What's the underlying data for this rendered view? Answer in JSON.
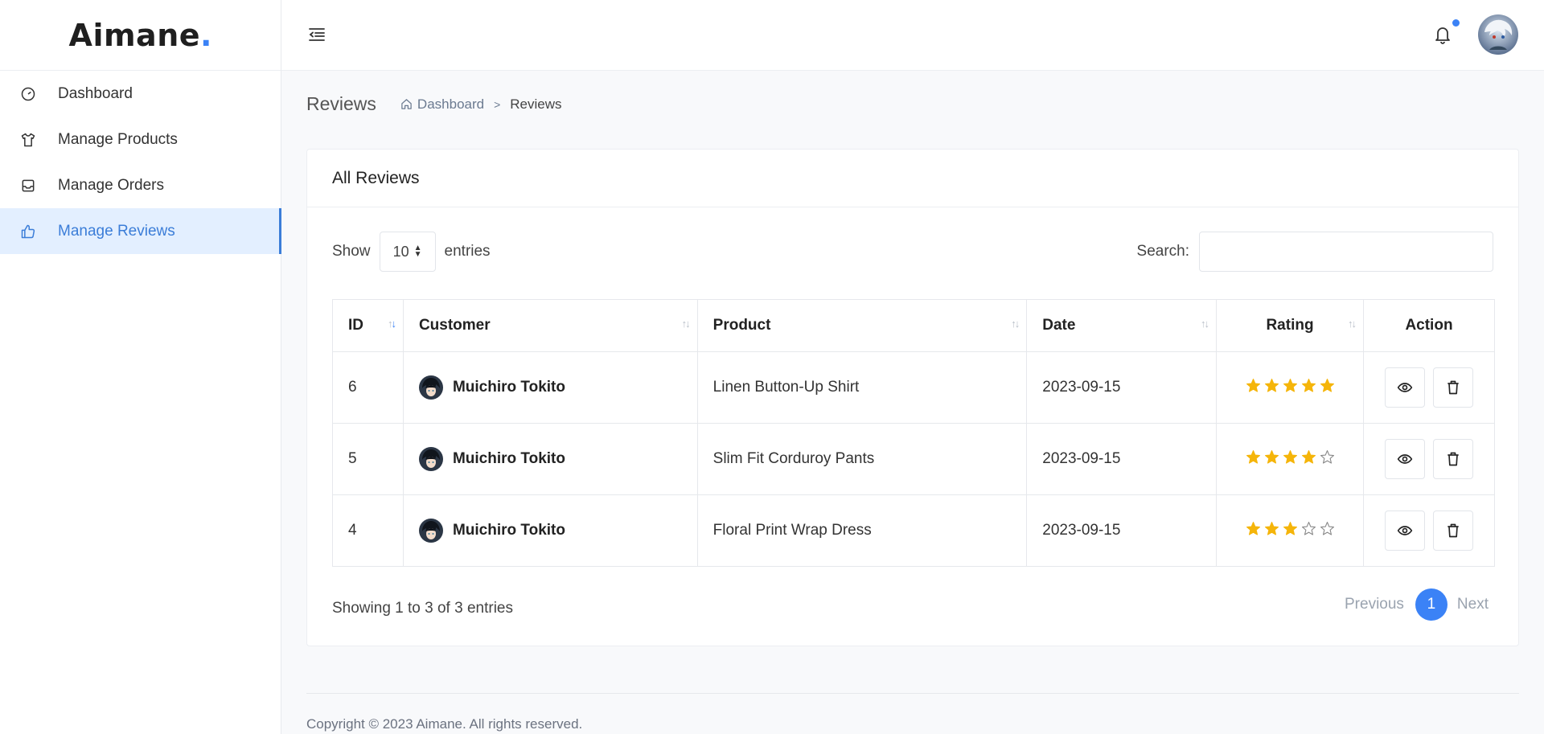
{
  "brand": {
    "name": "Aimane",
    "dot": "."
  },
  "sidebar": {
    "items": [
      {
        "label": "Dashboard"
      },
      {
        "label": "Manage Products"
      },
      {
        "label": "Manage Orders"
      },
      {
        "label": "Manage Reviews",
        "active": true
      }
    ]
  },
  "page": {
    "title": "Reviews"
  },
  "breadcrumb": {
    "home": "Dashboard",
    "separator": ">",
    "current": "Reviews"
  },
  "card": {
    "title": "All Reviews"
  },
  "controls": {
    "show_label": "Show",
    "entries_value": "10",
    "entries_label": "entries",
    "search_label": "Search:",
    "search_value": ""
  },
  "table": {
    "headers": {
      "id": "ID",
      "customer": "Customer",
      "product": "Product",
      "date": "Date",
      "rating": "Rating",
      "action": "Action"
    },
    "rows": [
      {
        "id": "6",
        "customer": "Muichiro Tokito",
        "product": "Linen Button-Up Shirt",
        "date": "2023-09-15",
        "rating": 5
      },
      {
        "id": "5",
        "customer": "Muichiro Tokito",
        "product": "Slim Fit Corduroy Pants",
        "date": "2023-09-15",
        "rating": 4
      },
      {
        "id": "4",
        "customer": "Muichiro Tokito",
        "product": "Floral Print Wrap Dress",
        "date": "2023-09-15",
        "rating": 3
      }
    ]
  },
  "footer_info": {
    "showing": "Showing 1 to 3 of 3 entries"
  },
  "pagination": {
    "previous": "Previous",
    "current_page": "1",
    "next": "Next"
  },
  "copyright": "Copyright © 2023 Aimane. All rights reserved.",
  "colors": {
    "accent": "#3b82f6",
    "star": "#f5b50a",
    "active_bg": "#e3efff"
  }
}
